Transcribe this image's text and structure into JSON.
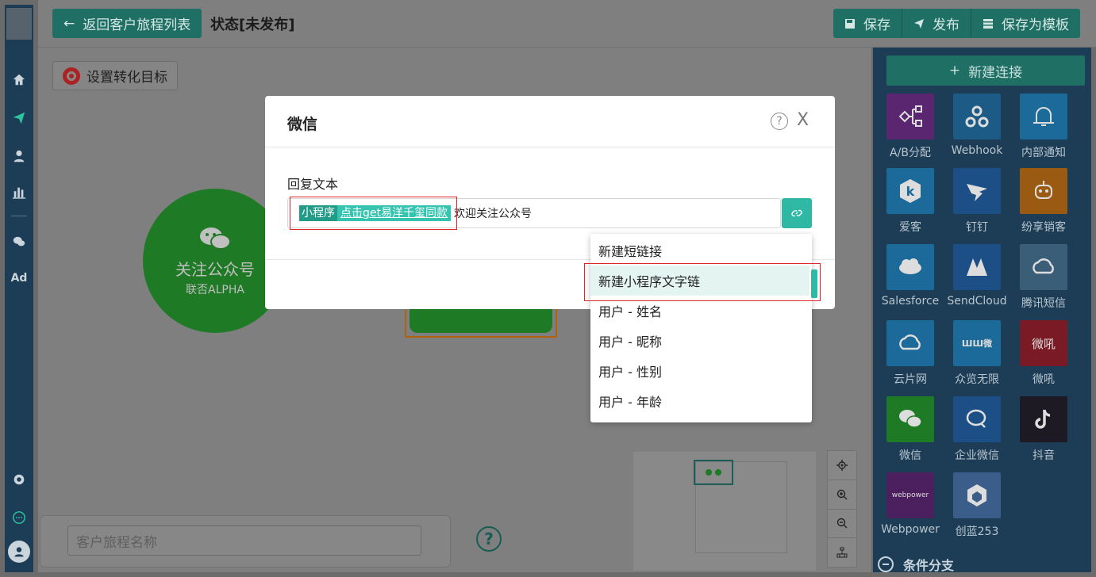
{
  "header": {
    "back_label": "返回客户旅程列表",
    "status_title": "状态[未发布]",
    "save_label": "保存",
    "publish_label": "发布",
    "save_template_label": "保存为模板"
  },
  "canvas": {
    "goal_button_label": "设置转化目标",
    "follow_node_title": "关注公众号",
    "follow_node_subtitle": "联否ALPHA",
    "journey_name_placeholder": "客户旅程名称",
    "help_glyph": "?"
  },
  "left_nav": {
    "items": [
      "home-icon",
      "send-icon",
      "user-icon",
      "bar-chart-icon",
      "wechat-icon"
    ],
    "ad_label": "Ad",
    "bottom": [
      "gear-icon",
      "chat-bubble-icon",
      "avatar"
    ]
  },
  "right_panel": {
    "new_connection_label": "新建连接",
    "tiles": [
      {
        "label": "A/B分配",
        "color": "#5a2670",
        "icon": "ab-split-icon"
      },
      {
        "label": "Webhook",
        "color": "#1c5b85",
        "icon": "webhook-icon"
      },
      {
        "label": "内部通知",
        "color": "#1c6a99",
        "icon": "bell-icon"
      },
      {
        "label": "爱客",
        "color": "#1c6a99",
        "icon": "k-hexagon-icon"
      },
      {
        "label": "钉钉",
        "color": "#1c4f85",
        "icon": "dingtalk-icon"
      },
      {
        "label": "纷享销客",
        "color": "#9a5a12",
        "icon": "robot-icon"
      },
      {
        "label": "Salesforce",
        "color": "#1c6a99",
        "icon": "cloud-icon"
      },
      {
        "label": "SendCloud",
        "color": "#1c4f85",
        "icon": "sendcloud-icon"
      },
      {
        "label": "腾讯短信",
        "color": "#3a5d78",
        "icon": "tencent-cloud-icon"
      },
      {
        "label": "云片网",
        "color": "#1c6a99",
        "icon": "yunpian-icon"
      },
      {
        "label": "众览无限",
        "color": "#1c6a99",
        "icon": "weiwei-icon"
      },
      {
        "label": "微吼",
        "color": "#7a1a24",
        "icon": "vhall-icon"
      },
      {
        "label": "微信",
        "color": "#1f7a25",
        "icon": "wechat-icon"
      },
      {
        "label": "企业微信",
        "color": "#1c4f85",
        "icon": "wecom-icon"
      },
      {
        "label": "抖音",
        "color": "#1e1a24",
        "icon": "douyin-icon"
      },
      {
        "label": "Webpower",
        "color": "#4c1f5e",
        "icon": "webpower-icon"
      },
      {
        "label": "创蓝253",
        "color": "#3a5d8a",
        "icon": "chuanglan-icon"
      }
    ],
    "webpower_logo_text": "webpower",
    "weiwei_logo_text": "ШШ微",
    "vhall_logo_text": "微吼",
    "condition_branch_label": "条件分支"
  },
  "modal": {
    "title": "微信",
    "reply_label": "回复文本",
    "chip_tag": "小程序",
    "chip_link": "点击get易洋千玺同款",
    "reply_rest_text": "欢迎关注公众号",
    "close_glyph": "X",
    "help_glyph": "?"
  },
  "dropdown": {
    "items": [
      "新建短链接",
      "新建小程序文字链",
      "用户 - 姓名",
      "用户 - 昵称",
      "用户 - 性别",
      "用户 - 年龄"
    ],
    "selected_index": 1
  },
  "colors": {
    "accent": "#2fb8a4",
    "primary_dark": "#1f6f65",
    "nav_bg": "#1c3d55",
    "highlight_red": "#e0242b"
  }
}
